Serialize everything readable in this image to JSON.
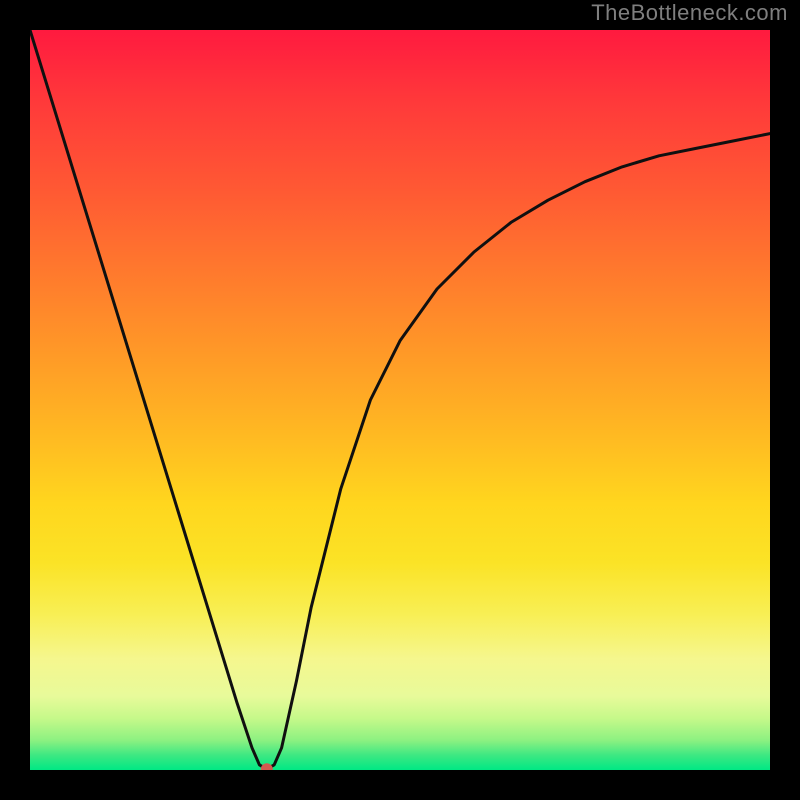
{
  "watermark": "TheBottleneck.com",
  "chart_data": {
    "type": "line",
    "title": "",
    "xlabel": "",
    "ylabel": "",
    "xlim": [
      0,
      100
    ],
    "ylim": [
      0,
      100
    ],
    "series": [
      {
        "name": "bottleneck-curve",
        "x": [
          0,
          4,
          8,
          12,
          16,
          20,
          24,
          28,
          30,
          31,
          32,
          33,
          34,
          36,
          38,
          42,
          46,
          50,
          55,
          60,
          65,
          70,
          75,
          80,
          85,
          90,
          95,
          100
        ],
        "values": [
          100,
          87,
          74,
          61,
          48,
          35,
          22,
          9,
          3,
          0.7,
          0.1,
          0.7,
          3,
          12,
          22,
          38,
          50,
          58,
          65,
          70,
          74,
          77,
          79.5,
          81.5,
          83,
          84,
          85,
          86
        ]
      }
    ],
    "marker": {
      "x": 32,
      "y": 0.1
    },
    "background_gradient": {
      "stops": [
        {
          "pos": 0.0,
          "color": "#ff1a3f"
        },
        {
          "pos": 0.33,
          "color": "#ff7a2d"
        },
        {
          "pos": 0.64,
          "color": "#ffd61e"
        },
        {
          "pos": 0.85,
          "color": "#f5f78e"
        },
        {
          "pos": 1.0,
          "color": "#00e884"
        }
      ]
    }
  }
}
